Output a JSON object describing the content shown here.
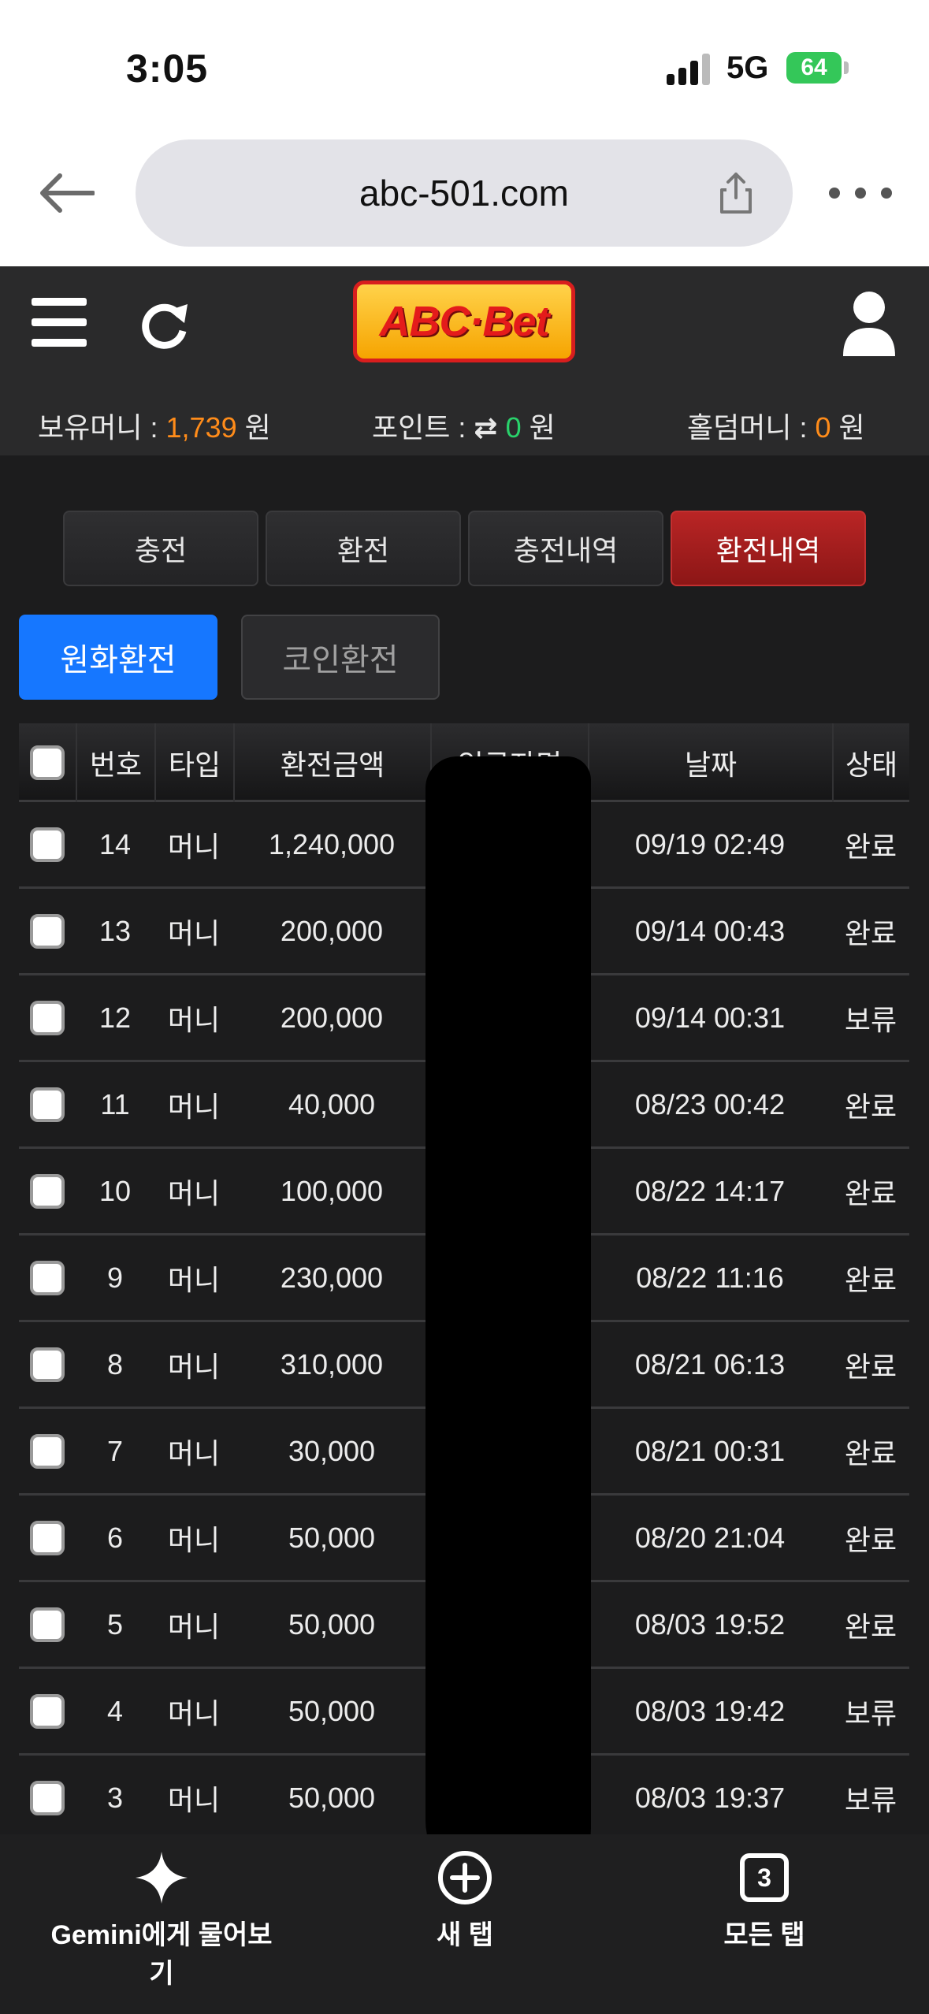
{
  "status_bar": {
    "time": "3:05",
    "network": "5G",
    "battery": "64"
  },
  "browser": {
    "url": "abc-501.com"
  },
  "site": {
    "logo": "ABC·Bet",
    "balances": {
      "money_label": "보유머니 :",
      "money_value": "1,739",
      "money_unit": "원",
      "point_label": "포인트 :",
      "point_value": "0",
      "point_unit": "원",
      "holdem_label": "홀덤머니 :",
      "holdem_value": "0",
      "holdem_unit": "원"
    },
    "tabs": [
      "충전",
      "환전",
      "충전내역",
      "환전내역"
    ],
    "active_tab": 3,
    "subtabs": [
      "원화환전",
      "코인환전"
    ]
  },
  "table": {
    "headers": [
      "번호",
      "타입",
      "환전금액",
      "입금자명",
      "날짜",
      "상태"
    ],
    "rows": [
      {
        "no": "14",
        "type": "머니",
        "amount": "1,240,000",
        "date": "09/19 02:49",
        "status": "완료"
      },
      {
        "no": "13",
        "type": "머니",
        "amount": "200,000",
        "date": "09/14 00:43",
        "status": "완료"
      },
      {
        "no": "12",
        "type": "머니",
        "amount": "200,000",
        "date": "09/14 00:31",
        "status": "보류"
      },
      {
        "no": "11",
        "type": "머니",
        "amount": "40,000",
        "date": "08/23 00:42",
        "status": "완료"
      },
      {
        "no": "10",
        "type": "머니",
        "amount": "100,000",
        "date": "08/22 14:17",
        "status": "완료"
      },
      {
        "no": "9",
        "type": "머니",
        "amount": "230,000",
        "date": "08/22 11:16",
        "status": "완료"
      },
      {
        "no": "8",
        "type": "머니",
        "amount": "310,000",
        "date": "08/21 06:13",
        "status": "완료"
      },
      {
        "no": "7",
        "type": "머니",
        "amount": "30,000",
        "date": "08/21 00:31",
        "status": "완료"
      },
      {
        "no": "6",
        "type": "머니",
        "amount": "50,000",
        "date": "08/20 21:04",
        "status": "완료"
      },
      {
        "no": "5",
        "type": "머니",
        "amount": "50,000",
        "date": "08/03 19:52",
        "status": "완료"
      },
      {
        "no": "4",
        "type": "머니",
        "amount": "50,000",
        "date": "08/03 19:42",
        "status": "보류"
      },
      {
        "no": "3",
        "type": "머니",
        "amount": "50,000",
        "date": "08/03 19:37",
        "status": "보류"
      }
    ]
  },
  "bottom_bar": {
    "gemini_label": "Gemini에게 물어보기",
    "new_tab_label": "새 탭",
    "all_tabs_label": "모든 탭",
    "tab_count": "3"
  }
}
